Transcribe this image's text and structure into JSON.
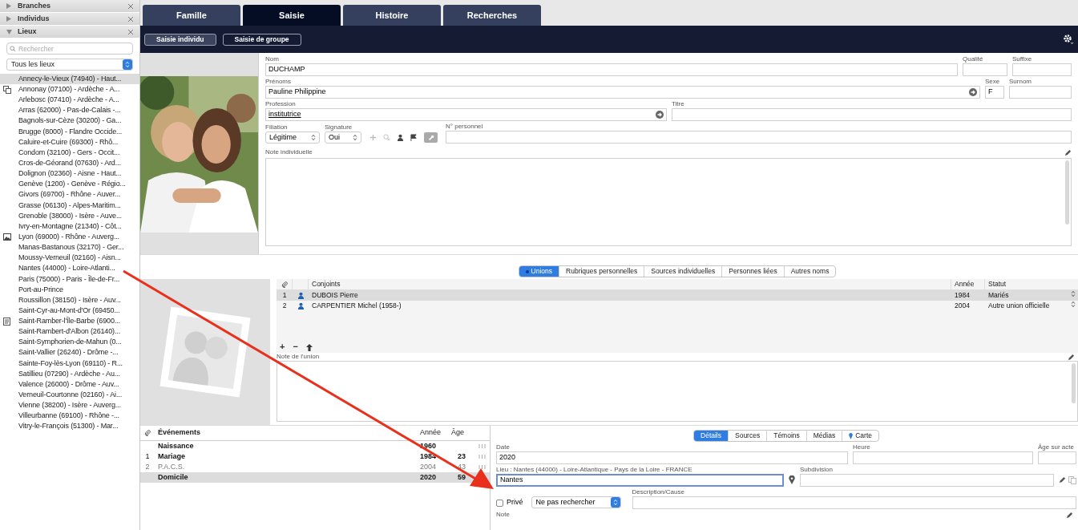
{
  "sidebar": {
    "sections": [
      {
        "title": "Branches",
        "expanded": false
      },
      {
        "title": "Individus",
        "expanded": false
      },
      {
        "title": "Lieux",
        "expanded": true
      }
    ],
    "search": {
      "placeholder": "Rechercher"
    },
    "filter": {
      "value": "Tous les lieux"
    },
    "places": [
      {
        "label": "Annecy-le-Vieux (74940) - Haut...",
        "kind": "plain",
        "selected": true
      },
      {
        "label": "Annonay (07100) - Ardèche - A...",
        "kind": "linked",
        "selected": false
      },
      {
        "label": "Arlebosc (07410) - Ardèche - A...",
        "kind": "plain",
        "selected": false
      },
      {
        "label": "Arras (62000) - Pas-de-Calais -...",
        "kind": "plain",
        "selected": false
      },
      {
        "label": "Bagnols-sur-Cèze (30200) - Ga...",
        "kind": "plain",
        "selected": false
      },
      {
        "label": "Brugge (8000) - Flandre Occide...",
        "kind": "plain",
        "selected": false
      },
      {
        "label": "Caluire-et-Cuire (69300) - Rhô...",
        "kind": "plain",
        "selected": false
      },
      {
        "label": "Condom (32100) - Gers - Occit...",
        "kind": "plain",
        "selected": false
      },
      {
        "label": "Cros-de-Géorand (07630) - Ard...",
        "kind": "plain",
        "selected": false
      },
      {
        "label": "Dolignon (02360) - Aisne - Haut...",
        "kind": "plain",
        "selected": false
      },
      {
        "label": "Genève (1200) - Genève - Régio...",
        "kind": "plain",
        "selected": false
      },
      {
        "label": "Givors (69700) - Rhône - Auver...",
        "kind": "plain",
        "selected": false
      },
      {
        "label": "Grasse (06130) - Alpes-Maritim...",
        "kind": "plain",
        "selected": false
      },
      {
        "label": "Grenoble (38000) - Isère - Auve...",
        "kind": "plain",
        "selected": false
      },
      {
        "label": "Ivry-en-Montagne (21340) - Côt...",
        "kind": "plain",
        "selected": false
      },
      {
        "label": "Lyon (69000) - Rhône - Auverg...",
        "selected": false
      },
      {
        "label": "Manas-Bastanous (32170) - Ger...",
        "kind": "plain",
        "selected": false
      },
      {
        "label": "Moussy-Verneuil (02160) - Aisn...",
        "kind": "plain",
        "selected": false
      },
      {
        "label": "Nantes (44000) - Loire-Atlanti...",
        "kind": "plain",
        "selected": false
      },
      {
        "label": "Paris (75000) - Paris - Île-de-Fr...",
        "kind": "plain",
        "selected": false
      },
      {
        "label": "Port-au-Prince",
        "kind": "plain",
        "selected": false
      },
      {
        "label": "Roussillon (38150) - Isère - Auv...",
        "kind": "plain",
        "selected": false
      },
      {
        "label": "Saint-Cyr-au-Mont-d'Or (69450...",
        "kind": "plain",
        "selected": false
      },
      {
        "label": "Saint-Ramber-l'Île-Barbe (6900...",
        "kind": "note",
        "selected": false
      },
      {
        "label": "Saint-Rambert-d'Albon (26140)...",
        "kind": "plain",
        "selected": false
      },
      {
        "label": "Saint-Symphorien-de-Mahun (0...",
        "kind": "plain",
        "selected": false
      },
      {
        "label": "Saint-Vallier (26240) - Drôme -...",
        "kind": "plain",
        "selected": false
      },
      {
        "label": "Sainte-Foy-lès-Lyon (69110) - R...",
        "kind": "plain",
        "selected": false
      },
      {
        "label": "Satillieu (07290) - Ardèche - Au...",
        "kind": "plain",
        "selected": false
      },
      {
        "label": "Valence (26000) - Drôme - Auv...",
        "kind": "plain",
        "selected": false
      },
      {
        "label": "Verneuil-Courtonne (02160) - Ai...",
        "kind": "plain",
        "selected": false
      },
      {
        "label": "Vienne (38200) - Isère - Auverg...",
        "kind": "plain",
        "selected": false
      },
      {
        "label": "Villeurbanne (69100) - Rhône -...",
        "kind": "plain",
        "selected": false
      },
      {
        "label": "Vitry-le-François (51300) - Mar...",
        "kind": "plain",
        "selected": false
      }
    ]
  },
  "tabs": [
    {
      "label": "Famille",
      "selected": false
    },
    {
      "label": "Saisie",
      "selected": true
    },
    {
      "label": "Histoire",
      "selected": false
    },
    {
      "label": "Recherches",
      "selected": false
    }
  ],
  "subtabs": [
    {
      "label": "Saisie individu",
      "selected": true
    },
    {
      "label": "Saisie de groupe",
      "selected": false
    }
  ],
  "individual": {
    "nom": {
      "label": "Nom",
      "value": "DUCHAMP"
    },
    "qualite": {
      "label": "Qualité"
    },
    "suffixe": {
      "label": "Suffixe"
    },
    "prenoms": {
      "label": "Prénoms",
      "value": "Pauline Philippine"
    },
    "sexe": {
      "label": "Sexe",
      "value": "F"
    },
    "surnom": {
      "label": "Surnom"
    },
    "profession": {
      "label": "Profession",
      "value": "institutrice"
    },
    "titre": {
      "label": "Titre"
    },
    "filiation": {
      "label": "Filiation",
      "value": "Légitime"
    },
    "signature": {
      "label": "Signature",
      "value": "Oui"
    },
    "numero": {
      "label": "N° personnel"
    },
    "note": {
      "label": "Note individuelle"
    }
  },
  "union_tabs": [
    {
      "label": "Unions",
      "selected": true
    },
    {
      "label": "Rubriques personnelles",
      "selected": false
    },
    {
      "label": "Sources individuelles",
      "selected": false
    },
    {
      "label": "Personnes liées",
      "selected": false
    },
    {
      "label": "Autres noms",
      "selected": false
    }
  ],
  "unions": {
    "columns": [
      "Conjoints",
      "Année",
      "Statut"
    ],
    "rows": [
      {
        "index": "1",
        "name": "DUBOIS Pierre",
        "year": "1984",
        "status": "Mariés",
        "selected": true
      },
      {
        "index": "2",
        "name": "CARPENTIER Michel (1958-)",
        "year": "2004",
        "status": "Autre union officielle",
        "selected": false
      }
    ],
    "buttons": [
      "+",
      "−"
    ],
    "note_label": "Note de l'union"
  },
  "events": {
    "columns": [
      "Événements",
      "Année",
      "Âge"
    ],
    "rows": [
      {
        "index": "",
        "name": "Naissance",
        "year": "1960",
        "age": "",
        "selected": false,
        "disabled": false
      },
      {
        "index": "1",
        "name": "Mariage",
        "year": "1984",
        "age": "23",
        "selected": false,
        "disabled": false
      },
      {
        "index": "2",
        "name": "P.A.C.S.",
        "year": "2004",
        "age": "43",
        "selected": false,
        "disabled": true
      },
      {
        "index": "",
        "name": "Domicile",
        "year": "2020",
        "age": "59",
        "selected": true,
        "disabled": false
      }
    ]
  },
  "detail_tabs": [
    {
      "label": "Détails",
      "selected": true
    },
    {
      "label": "Sources",
      "selected": false
    },
    {
      "label": "Témoins",
      "selected": false
    },
    {
      "label": "Médias",
      "selected": false
    },
    {
      "label": "Carte",
      "selected": false
    }
  ],
  "details": {
    "date": {
      "label": "Date",
      "value": "2020"
    },
    "heure": {
      "label": "Heure"
    },
    "age": {
      "label": "Âge sur acte"
    },
    "lieu": {
      "label": "Lieu : Nantes (44000) - Loire-Atlantique - Pays de la Loire - FRANCE",
      "value": "Nantes"
    },
    "subdivision": {
      "label": "Subdivision"
    },
    "prive": {
      "label": "Privé",
      "checked": false
    },
    "recherche": {
      "value": "Ne pas rechercher"
    },
    "description": {
      "label": "Description/Cause"
    },
    "note": {
      "label": "Note"
    }
  }
}
